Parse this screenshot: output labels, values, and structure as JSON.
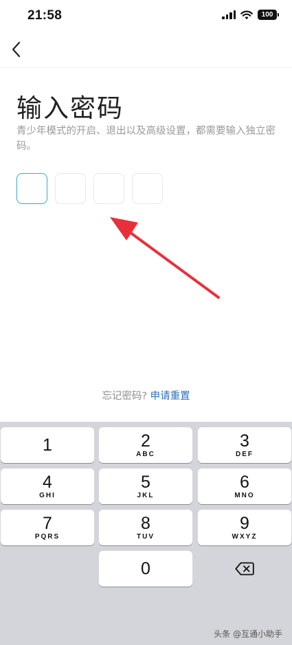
{
  "status_bar": {
    "time": "21:58",
    "battery": "100"
  },
  "nav": {
    "back_icon": "chevron-left-icon"
  },
  "page": {
    "title": "输入密码",
    "subtitle": "青少年模式的开启、退出以及高级设置，都需要输入独立密码。"
  },
  "code_input": {
    "length": 4,
    "active_index": 0
  },
  "forgot": {
    "text": "忘记密码?",
    "link": "申请重置"
  },
  "keypad": {
    "keys": [
      {
        "digit": "1",
        "letters": ""
      },
      {
        "digit": "2",
        "letters": "ABC"
      },
      {
        "digit": "3",
        "letters": "DEF"
      },
      {
        "digit": "4",
        "letters": "GHI"
      },
      {
        "digit": "5",
        "letters": "JKL"
      },
      {
        "digit": "6",
        "letters": "MNO"
      },
      {
        "digit": "7",
        "letters": "PQRS"
      },
      {
        "digit": "8",
        "letters": "TUV"
      },
      {
        "digit": "9",
        "letters": "WXYZ"
      },
      {
        "digit": "0",
        "letters": ""
      }
    ],
    "delete_icon": "backspace-icon"
  },
  "watermark": "头条 @互通小助手",
  "colors": {
    "accent": "#3aa6c9",
    "link": "#2f6fb6",
    "annotation_arrow": "#e8303a",
    "keypad_bg": "#d4d5da"
  }
}
